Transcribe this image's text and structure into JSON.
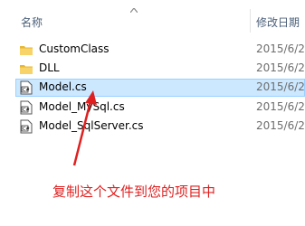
{
  "header": {
    "name_label": "名称",
    "date_label": "修改日期"
  },
  "files": [
    {
      "name": "CustomClass",
      "date": "2015/6/2",
      "type": "folder",
      "selected": false
    },
    {
      "name": "DLL",
      "date": "2015/6/2",
      "type": "folder",
      "selected": false
    },
    {
      "name": "Model.cs",
      "date": "2015/6/2",
      "type": "cs-file",
      "selected": true
    },
    {
      "name": "Model_MySql.cs",
      "date": "2015/6/2",
      "type": "cs-file",
      "selected": false
    },
    {
      "name": "Model_SqlServer.cs",
      "date": "2015/6/2",
      "type": "cs-file",
      "selected": false
    }
  ],
  "annotation": {
    "text": "复制这个文件到您的项目中",
    "color": "#e02020"
  },
  "colors": {
    "selection_bg": "#cce8ff",
    "selection_border": "#99d1ff",
    "folder": "#f0c040"
  }
}
